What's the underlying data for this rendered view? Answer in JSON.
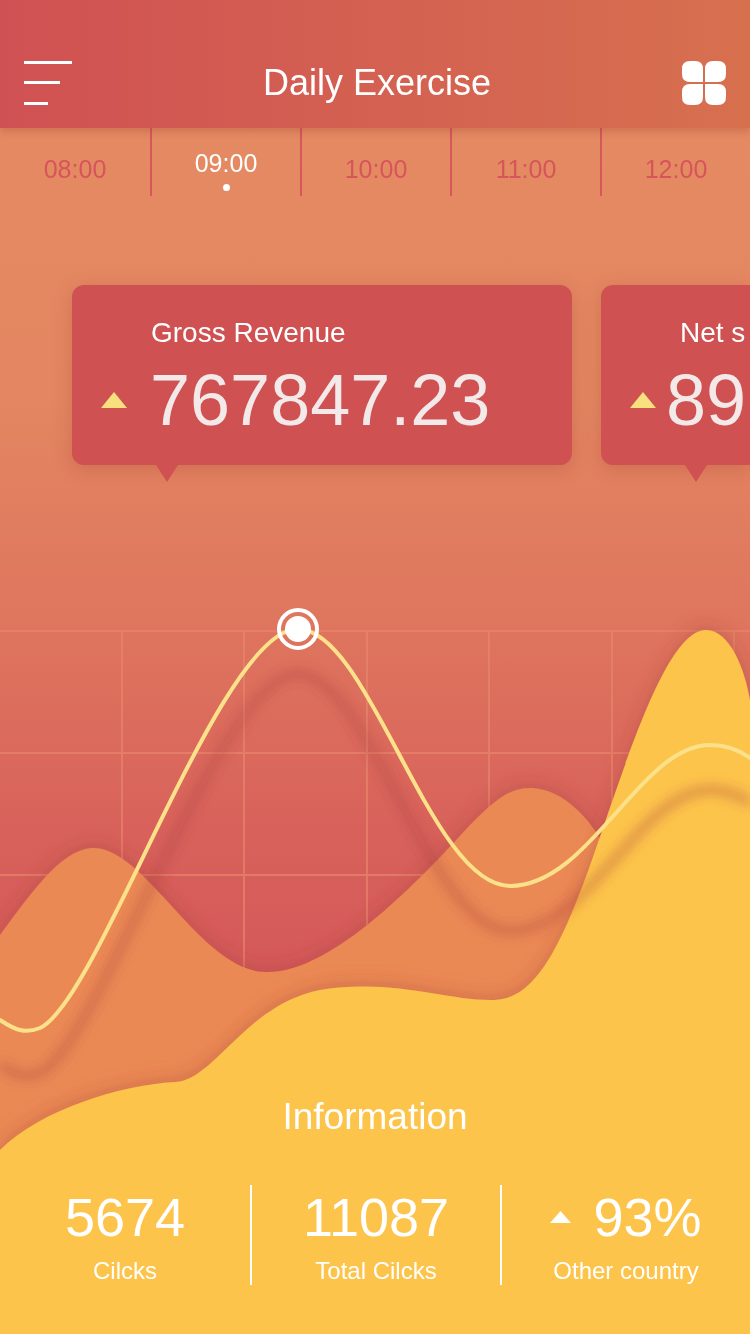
{
  "header": {
    "title": "Daily Exercise"
  },
  "time_tabs": [
    {
      "label": "08:00",
      "selected": false
    },
    {
      "label": "09:00",
      "selected": true
    },
    {
      "label": "10:00",
      "selected": false
    },
    {
      "label": "11:00",
      "selected": false
    },
    {
      "label": "12:00",
      "selected": false
    }
  ],
  "cards": [
    {
      "label": "Gross Revenue",
      "value": "767847.23",
      "rising": true
    },
    {
      "label": "Net s",
      "value": "89",
      "rising": true
    }
  ],
  "information": {
    "title": "Information",
    "stats": [
      {
        "value": "5674",
        "label": "Cilcks"
      },
      {
        "value": "11087",
        "label": "Total Cilcks"
      },
      {
        "value": "93%",
        "label": "Other country",
        "rising": true
      }
    ]
  }
}
